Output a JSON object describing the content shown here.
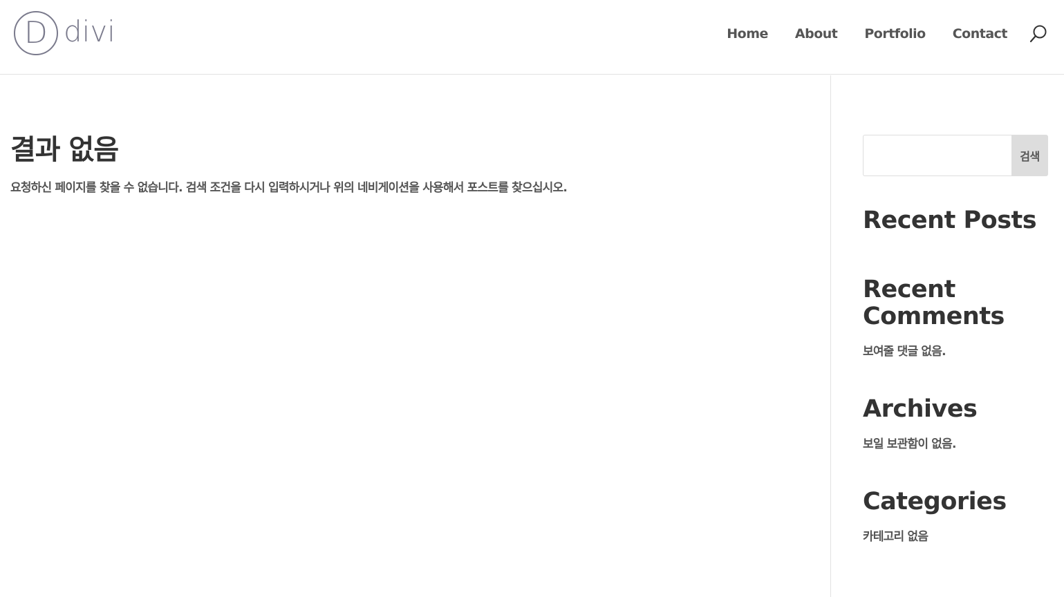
{
  "header": {
    "logo_mark": "D",
    "logo_text": "divi",
    "nav": [
      {
        "label": "Home"
      },
      {
        "label": "About"
      },
      {
        "label": "Portfolio"
      },
      {
        "label": "Contact"
      }
    ],
    "search_icon": "search-icon"
  },
  "main": {
    "title": "결과 없음",
    "message": "요청하신 페이지를 찾을 수 없습니다. 검색 조건을 다시 입력하시거나 위의 네비게이션을 사용해서 포스트를 찾으십시오."
  },
  "sidebar": {
    "search": {
      "value": "",
      "button_label": "검색"
    },
    "recent_posts": {
      "title": "Recent Posts"
    },
    "recent_comments": {
      "title": "Recent Comments",
      "text": "보여줄 댓글 없음."
    },
    "archives": {
      "title": "Archives",
      "text": "보일 보관함이 없음."
    },
    "categories": {
      "title": "Categories",
      "text": "카테고리 없음"
    }
  },
  "colors": {
    "logo": "#7a7a8c",
    "nav_text": "#555555",
    "heading": "#333333",
    "body_text": "#555555",
    "border": "#e2e2e2",
    "button_bg": "#dddddd"
  }
}
